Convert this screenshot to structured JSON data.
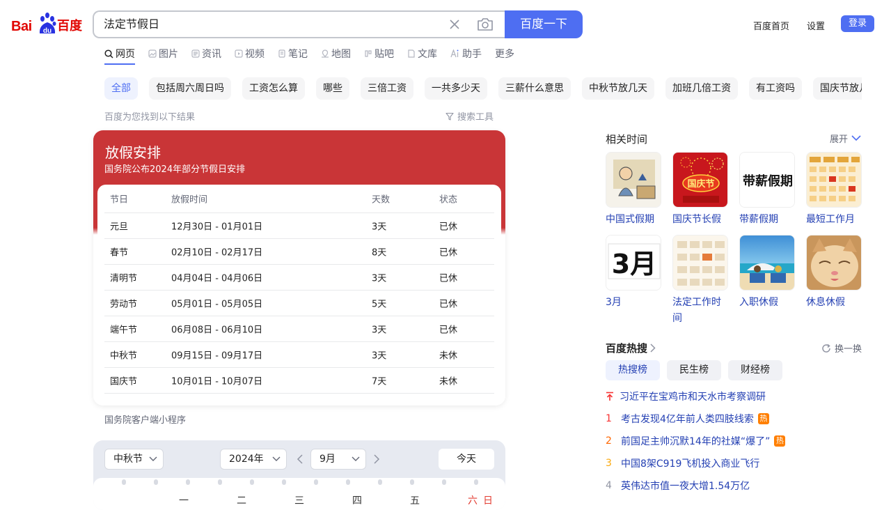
{
  "logo": {
    "latin": "Bai",
    "paw_text": "du",
    "chinese": "百度"
  },
  "search": {
    "query": "法定节假日",
    "button_label": "百度一下"
  },
  "top_links": {
    "home": "百度首页",
    "settings": "设置",
    "login": "登录"
  },
  "tabs": [
    "网页",
    "图片",
    "资讯",
    "视频",
    "笔记",
    "地图",
    "贴吧",
    "文库",
    "助手",
    "更多"
  ],
  "chips": [
    "全部",
    "包括周六周日吗",
    "工资怎么算",
    "哪些",
    "三倍工资",
    "一共多少天",
    "三薪什么意思",
    "中秋节放几天",
    "加班几倍工资",
    "有工资吗",
    "国庆节放几"
  ],
  "result_count": "百度为您找到以下结果",
  "search_tools": "搜索工具",
  "holiday": {
    "title": "放假安排",
    "subtitle": "国务院公布2024年部分节假日安排",
    "headers": [
      "节日",
      "放假时间",
      "天数",
      "状态"
    ],
    "rows": [
      [
        "元旦",
        "12月30日 - 01月01日",
        "3天",
        "已休"
      ],
      [
        "春节",
        "02月10日 - 02月17日",
        "8天",
        "已休"
      ],
      [
        "清明节",
        "04月04日 - 04月06日",
        "3天",
        "已休"
      ],
      [
        "劳动节",
        "05月01日 - 05月05日",
        "5天",
        "已休"
      ],
      [
        "端午节",
        "06月08日 - 06月10日",
        "3天",
        "已休"
      ],
      [
        "中秋节",
        "09月15日 - 09月17日",
        "3天",
        "未休"
      ],
      [
        "国庆节",
        "10月01日 - 10月07日",
        "7天",
        "未休"
      ]
    ],
    "miniapp": "国务院客户端小程序"
  },
  "calendar": {
    "holiday_select": "中秋节",
    "year_select": "2024年",
    "month_select": "9月",
    "today_label": "今天",
    "weekdays": [
      "一",
      "二",
      "三",
      "四",
      "五",
      "六",
      "日"
    ]
  },
  "related": {
    "title": "相关时间",
    "expand": "展开",
    "items": [
      {
        "label": "中国式假期",
        "icon": "cartoon-vacation-image"
      },
      {
        "label": "国庆节长假",
        "icon": "national-day-fireworks-image",
        "image_text": "国庆节"
      },
      {
        "label": "带薪假期",
        "icon": "paid-leave-calligraphy-image",
        "image_text": "带薪假期"
      },
      {
        "label": "最短工作月",
        "icon": "calendar-grid-image"
      },
      {
        "label": "3月",
        "icon": "march-calendar-image",
        "image_text": "3月"
      },
      {
        "label": "法定工作时间",
        "icon": "work-calendar-image"
      },
      {
        "label": "入职休假",
        "icon": "beach-vacation-image"
      },
      {
        "label": "休息休假",
        "icon": "sleepy-kitten-image"
      }
    ]
  },
  "hot": {
    "title": "百度热搜",
    "refresh": "换一换",
    "tabs": [
      "热搜榜",
      "民生榜",
      "财经榜"
    ],
    "items": [
      {
        "rank": "",
        "text": "习近平在宝鸡市和天水市考察调研",
        "badge": ""
      },
      {
        "rank": "1",
        "text": "考古发现4亿年前人类四肢线索",
        "badge": "热"
      },
      {
        "rank": "2",
        "text": "前国足主帅沉默14年的社媒“爆了”",
        "badge": "热"
      },
      {
        "rank": "3",
        "text": "中国8架C919飞机投入商业飞行",
        "badge": ""
      },
      {
        "rank": "4",
        "text": "英伟达市值一夜大增1.54万亿",
        "badge": ""
      }
    ]
  },
  "colors": {
    "brand_blue": "#4e6ef2",
    "card_red": "#c93537",
    "link_blue": "#2440b3",
    "hot_orange": "#ff7f00"
  }
}
